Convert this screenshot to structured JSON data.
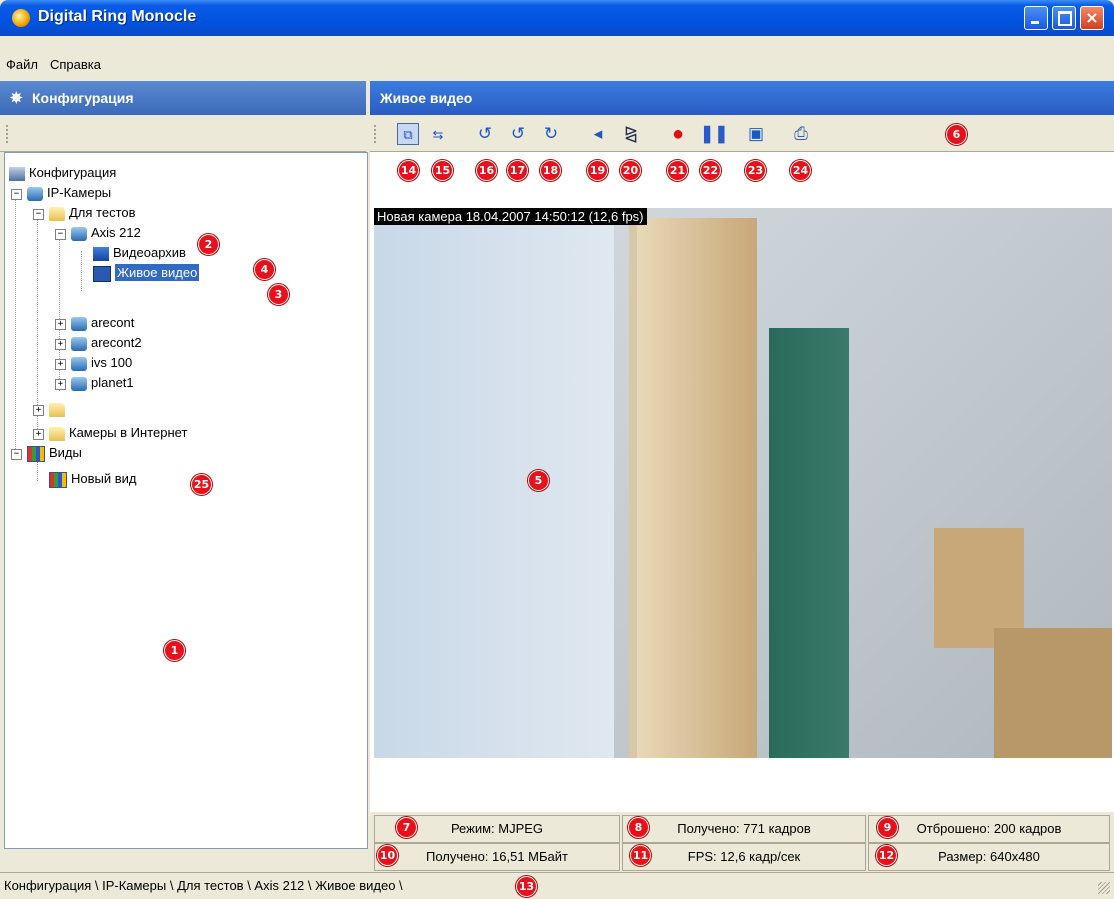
{
  "window": {
    "title": "Digital Ring Monocle"
  },
  "menu": [
    "Файл",
    "Справка"
  ],
  "left_panel": {
    "title": "Конфигурация"
  },
  "tree": [
    {
      "label": "Конфигурация"
    },
    {
      "label": "IP-Камеры"
    },
    {
      "label": "Для тестов"
    },
    {
      "label": "Axis 212"
    },
    {
      "label": "Видеоархив"
    },
    {
      "label": "Живое видео"
    },
    {
      "label": "arecont"
    },
    {
      "label": "arecont2"
    },
    {
      "label": "ivs 100"
    },
    {
      "label": "planet1"
    },
    {
      "label": ""
    },
    {
      "label": "Камеры в Интернет"
    },
    {
      "label": "Виды"
    },
    {
      "label": "Новый вид"
    }
  ],
  "right_panel": {
    "title": "Живое видео"
  },
  "video": {
    "overlay": "Новая камера 18.04.2007 14:50:12  (12,6 fps)"
  },
  "status": {
    "mode": "Режим: MJPEG",
    "received_frames": "Получено: 771 кадров",
    "dropped_frames": "Отброшено: 200 кадров",
    "received_bytes": "Получено: 16,51 МБайт",
    "fps": "FPS: 12,6 кадр/сек",
    "size": "Размер: 640x480"
  },
  "breadcrumb": "Конфигурация \\ IP-Камеры \\ Для тестов \\ Axis 212 \\ Живое видео \\",
  "callouts": [
    "1",
    "2",
    "3",
    "4",
    "5",
    "6",
    "7",
    "8",
    "9",
    "10",
    "11",
    "12",
    "13",
    "14",
    "15",
    "16",
    "17",
    "18",
    "19",
    "20",
    "21",
    "22",
    "23",
    "24",
    "25"
  ]
}
